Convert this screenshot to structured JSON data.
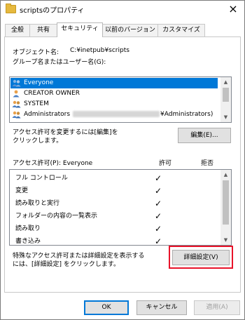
{
  "window": {
    "title": "scriptsのプロパティ"
  },
  "tabs": [
    {
      "label": "全般"
    },
    {
      "label": "共有"
    },
    {
      "label": "セキュリティ"
    },
    {
      "label": "以前のバージョン"
    },
    {
      "label": "カスタマイズ"
    }
  ],
  "object": {
    "label": "オブジェクト名:",
    "value": "C:¥inetpub¥scripts"
  },
  "groups": {
    "label": "グループ名またはユーザー名(G):",
    "items": [
      {
        "name": "Everyone",
        "selected": true
      },
      {
        "name": "CREATOR OWNER",
        "selected": false
      },
      {
        "name": "SYSTEM",
        "selected": false
      },
      {
        "name": "Administrators",
        "suffix": "¥Administrators)",
        "selected": false
      }
    ]
  },
  "edit": {
    "hint_line1": "アクセス許可を変更するには[編集]を",
    "hint_line2": "クリックします。",
    "button": "編集(E)..."
  },
  "permissions": {
    "label": "アクセス許可(P): Everyone",
    "allow_header": "許可",
    "deny_header": "拒否",
    "items": [
      {
        "name": "フル コントロール",
        "allow": true
      },
      {
        "name": "変更",
        "allow": true
      },
      {
        "name": "読み取りと実行",
        "allow": true
      },
      {
        "name": "フォルダーの内容の一覧表示",
        "allow": true
      },
      {
        "name": "読み取り",
        "allow": true
      },
      {
        "name": "書き込み",
        "allow": true
      }
    ],
    "check_mark": "✓"
  },
  "advanced": {
    "hint_line1": "特殊なアクセス許可または詳細設定を表示する",
    "hint_line2": "には、[詳細設定] をクリックします。",
    "button": "詳細設定(V)",
    "highlight_color": "#e8132a"
  },
  "footer": {
    "ok": "OK",
    "cancel": "キャンセル",
    "apply": "適用(A)"
  },
  "icons": {
    "close": "×",
    "user_group": "users-icon"
  },
  "colors": {
    "selection": "#0078d7"
  }
}
